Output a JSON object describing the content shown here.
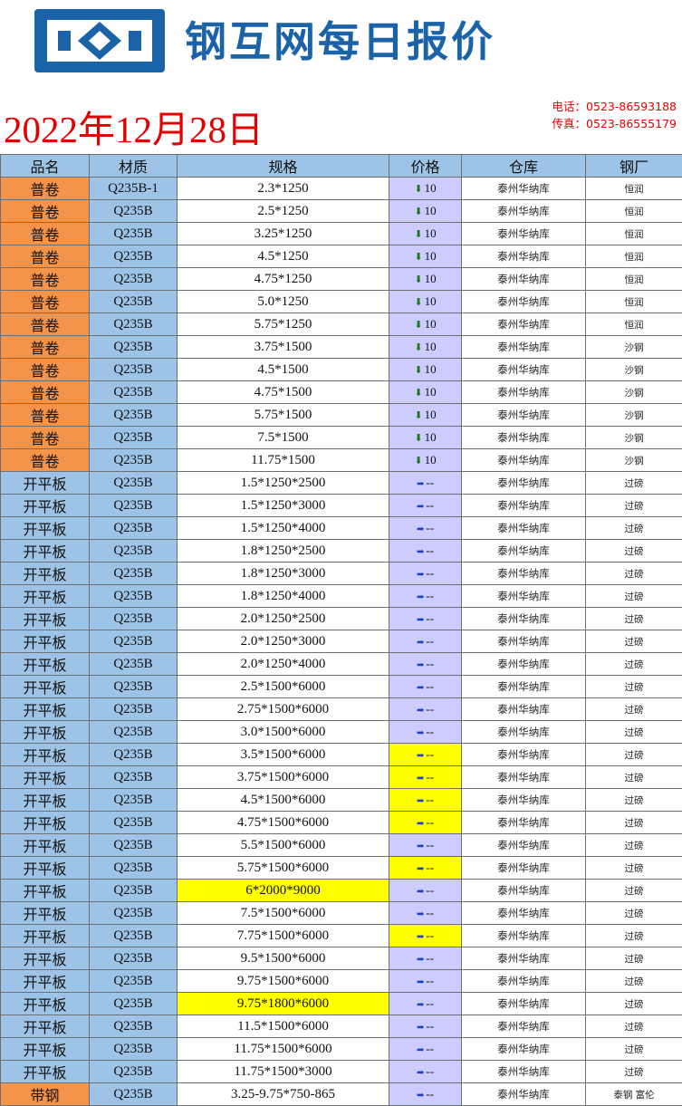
{
  "header": {
    "brand": "钢互网每日报价",
    "date": "2022年12月28日",
    "phone": "电话：0523-86593188",
    "fax": "传真：0523-86555179"
  },
  "colors": {
    "brand_blue": "#1a63a8",
    "date_red": "#e20000",
    "header_blue": "#9dc3e6",
    "orange": "#f4934a",
    "price_lavender": "#ccccff",
    "highlight_yellow": "#ffff00"
  },
  "icons": {
    "down": "down-arrow-icon",
    "flat": "right-arrow-icon"
  },
  "table": {
    "columns": [
      "品名",
      "材质",
      "规格",
      "价格",
      "仓库",
      "钢厂"
    ],
    "rows": [
      {
        "name": "普卷",
        "material": "Q235B-1",
        "spec": "2.3*1250",
        "trend": "down",
        "price": "10",
        "warehouse": "泰州华纳库",
        "mill": "恒润"
      },
      {
        "name": "普卷",
        "material": "Q235B",
        "spec": "2.5*1250",
        "trend": "down",
        "price": "10",
        "warehouse": "泰州华纳库",
        "mill": "恒润"
      },
      {
        "name": "普卷",
        "material": "Q235B",
        "spec": "3.25*1250",
        "trend": "down",
        "price": "10",
        "warehouse": "泰州华纳库",
        "mill": "恒润"
      },
      {
        "name": "普卷",
        "material": "Q235B",
        "spec": "4.5*1250",
        "trend": "down",
        "price": "10",
        "warehouse": "泰州华纳库",
        "mill": "恒润"
      },
      {
        "name": "普卷",
        "material": "Q235B",
        "spec": "4.75*1250",
        "trend": "down",
        "price": "10",
        "warehouse": "泰州华纳库",
        "mill": "恒润"
      },
      {
        "name": "普卷",
        "material": "Q235B",
        "spec": "5.0*1250",
        "trend": "down",
        "price": "10",
        "warehouse": "泰州华纳库",
        "mill": "恒润"
      },
      {
        "name": "普卷",
        "material": "Q235B",
        "spec": "5.75*1250",
        "trend": "down",
        "price": "10",
        "warehouse": "泰州华纳库",
        "mill": "恒润"
      },
      {
        "name": "普卷",
        "material": "Q235B",
        "spec": "3.75*1500",
        "trend": "down",
        "price": "10",
        "warehouse": "泰州华纳库",
        "mill": "沙钢"
      },
      {
        "name": "普卷",
        "material": "Q235B",
        "spec": "4.5*1500",
        "trend": "down",
        "price": "10",
        "warehouse": "泰州华纳库",
        "mill": "沙钢"
      },
      {
        "name": "普卷",
        "material": "Q235B",
        "spec": "4.75*1500",
        "trend": "down",
        "price": "10",
        "warehouse": "泰州华纳库",
        "mill": "沙钢"
      },
      {
        "name": "普卷",
        "material": "Q235B",
        "spec": "5.75*1500",
        "trend": "down",
        "price": "10",
        "warehouse": "泰州华纳库",
        "mill": "沙钢"
      },
      {
        "name": "普卷",
        "material": "Q235B",
        "spec": "7.5*1500",
        "trend": "down",
        "price": "10",
        "warehouse": "泰州华纳库",
        "mill": "沙钢"
      },
      {
        "name": "普卷",
        "material": "Q235B",
        "spec": "11.75*1500",
        "trend": "down",
        "price": "10",
        "warehouse": "泰州华纳库",
        "mill": "沙钢"
      },
      {
        "name": "开平板",
        "material": "Q235B",
        "spec": "1.5*1250*2500",
        "trend": "flat",
        "price": "--",
        "warehouse": "泰州华纳库",
        "mill": "过磅"
      },
      {
        "name": "开平板",
        "material": "Q235B",
        "spec": "1.5*1250*3000",
        "trend": "flat",
        "price": "--",
        "warehouse": "泰州华纳库",
        "mill": "过磅"
      },
      {
        "name": "开平板",
        "material": "Q235B",
        "spec": "1.5*1250*4000",
        "trend": "flat",
        "price": "--",
        "warehouse": "泰州华纳库",
        "mill": "过磅"
      },
      {
        "name": "开平板",
        "material": "Q235B",
        "spec": "1.8*1250*2500",
        "trend": "flat",
        "price": "--",
        "warehouse": "泰州华纳库",
        "mill": "过磅"
      },
      {
        "name": "开平板",
        "material": "Q235B",
        "spec": "1.8*1250*3000",
        "trend": "flat",
        "price": "--",
        "warehouse": "泰州华纳库",
        "mill": "过磅"
      },
      {
        "name": "开平板",
        "material": "Q235B",
        "spec": "1.8*1250*4000",
        "trend": "flat",
        "price": "--",
        "warehouse": "泰州华纳库",
        "mill": "过磅"
      },
      {
        "name": "开平板",
        "material": "Q235B",
        "spec": "2.0*1250*2500",
        "trend": "flat",
        "price": "--",
        "warehouse": "泰州华纳库",
        "mill": "过磅"
      },
      {
        "name": "开平板",
        "material": "Q235B",
        "spec": "2.0*1250*3000",
        "trend": "flat",
        "price": "--",
        "warehouse": "泰州华纳库",
        "mill": "过磅"
      },
      {
        "name": "开平板",
        "material": "Q235B",
        "spec": "2.0*1250*4000",
        "trend": "flat",
        "price": "--",
        "warehouse": "泰州华纳库",
        "mill": "过磅"
      },
      {
        "name": "开平板",
        "material": "Q235B",
        "spec": "2.5*1500*6000",
        "trend": "flat",
        "price": "--",
        "warehouse": "泰州华纳库",
        "mill": "过磅"
      },
      {
        "name": "开平板",
        "material": "Q235B",
        "spec": "2.75*1500*6000",
        "trend": "flat",
        "price": "--",
        "warehouse": "泰州华纳库",
        "mill": "过磅"
      },
      {
        "name": "开平板",
        "material": "Q235B",
        "spec": "3.0*1500*6000",
        "trend": "flat",
        "price": "--",
        "warehouse": "泰州华纳库",
        "mill": "过磅"
      },
      {
        "name": "开平板",
        "material": "Q235B",
        "spec": "3.5*1500*6000",
        "trend": "flat",
        "price": "--",
        "warehouse": "泰州华纳库",
        "mill": "过磅",
        "price_highlight": true
      },
      {
        "name": "开平板",
        "material": "Q235B",
        "spec": "3.75*1500*6000",
        "trend": "flat",
        "price": "--",
        "warehouse": "泰州华纳库",
        "mill": "过磅",
        "price_highlight": true
      },
      {
        "name": "开平板",
        "material": "Q235B",
        "spec": "4.5*1500*6000",
        "trend": "flat",
        "price": "--",
        "warehouse": "泰州华纳库",
        "mill": "过磅",
        "price_highlight": true
      },
      {
        "name": "开平板",
        "material": "Q235B",
        "spec": "4.75*1500*6000",
        "trend": "flat",
        "price": "--",
        "warehouse": "泰州华纳库",
        "mill": "过磅",
        "price_highlight": true
      },
      {
        "name": "开平板",
        "material": "Q235B",
        "spec": "5.5*1500*6000",
        "trend": "flat",
        "price": "--",
        "warehouse": "泰州华纳库",
        "mill": "过磅"
      },
      {
        "name": "开平板",
        "material": "Q235B",
        "spec": "5.75*1500*6000",
        "trend": "flat",
        "price": "--",
        "warehouse": "泰州华纳库",
        "mill": "过磅",
        "price_highlight": true
      },
      {
        "name": "开平板",
        "material": "Q235B",
        "spec": "6*2000*9000",
        "trend": "flat",
        "price": "--",
        "warehouse": "泰州华纳库",
        "mill": "过磅",
        "spec_highlight": true
      },
      {
        "name": "开平板",
        "material": "Q235B",
        "spec": "7.5*1500*6000",
        "trend": "flat",
        "price": "--",
        "warehouse": "泰州华纳库",
        "mill": "过磅"
      },
      {
        "name": "开平板",
        "material": "Q235B",
        "spec": "7.75*1500*6000",
        "trend": "flat",
        "price": "--",
        "warehouse": "泰州华纳库",
        "mill": "过磅",
        "price_highlight": true
      },
      {
        "name": "开平板",
        "material": "Q235B",
        "spec": "9.5*1500*6000",
        "trend": "flat",
        "price": "--",
        "warehouse": "泰州华纳库",
        "mill": "过磅"
      },
      {
        "name": "开平板",
        "material": "Q235B",
        "spec": "9.75*1500*6000",
        "trend": "flat",
        "price": "--",
        "warehouse": "泰州华纳库",
        "mill": "过磅"
      },
      {
        "name": "开平板",
        "material": "Q235B",
        "spec": "9.75*1800*6000",
        "trend": "flat",
        "price": "--",
        "warehouse": "泰州华纳库",
        "mill": "过磅",
        "spec_highlight": true
      },
      {
        "name": "开平板",
        "material": "Q235B",
        "spec": "11.5*1500*6000",
        "trend": "flat",
        "price": "--",
        "warehouse": "泰州华纳库",
        "mill": "过磅"
      },
      {
        "name": "开平板",
        "material": "Q235B",
        "spec": "11.75*1500*6000",
        "trend": "flat",
        "price": "--",
        "warehouse": "泰州华纳库",
        "mill": "过磅"
      },
      {
        "name": "开平板",
        "material": "Q235B",
        "spec": "11.75*1500*3000",
        "trend": "flat",
        "price": "--",
        "warehouse": "泰州华纳库",
        "mill": "过磅"
      },
      {
        "name": "带钢",
        "material": "Q235B",
        "spec": "3.25-9.75*750-865",
        "trend": "flat",
        "price": "--",
        "warehouse": "泰州华纳库",
        "mill": "泰钢 富伦"
      }
    ]
  }
}
